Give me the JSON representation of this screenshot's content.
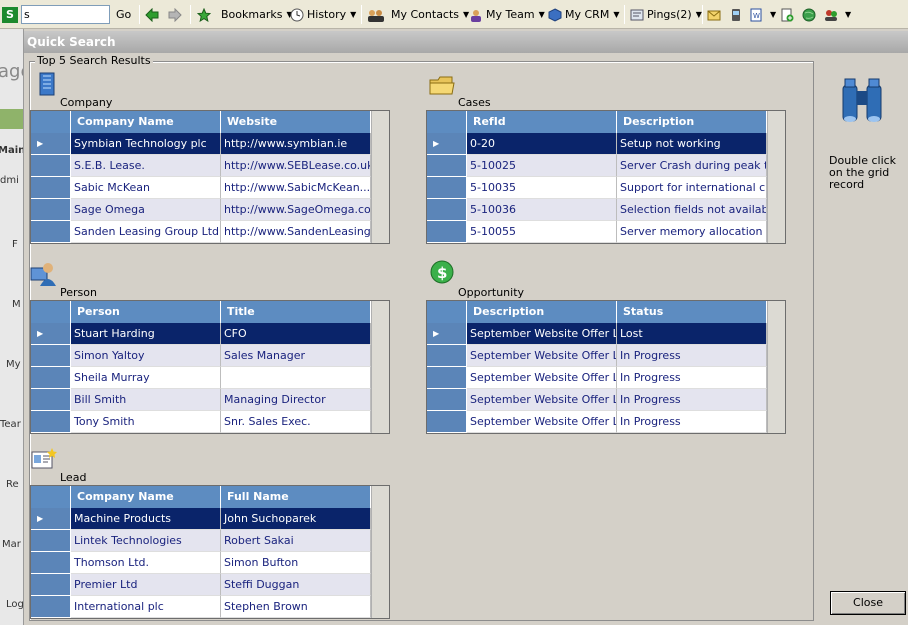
{
  "toolbar": {
    "app_badge": "S",
    "search_value": "s",
    "go_label": "Go",
    "bookmarks_label": "Bookmarks",
    "history_label": "History",
    "contacts_label": "My Contacts",
    "team_label": "My Team",
    "crm_label": "My CRM",
    "pings_label": "Pings(2)"
  },
  "sidebar": {
    "frag_top": "age",
    "frag_main": "Main",
    "frag_admin": "dmi",
    "frag_f": "F",
    "frag_m": "M",
    "frag_my": "My",
    "frag_team": "Tear",
    "frag_re": "Re",
    "frag_mar": "Mar",
    "frag_log": "Log"
  },
  "quick_search": {
    "title": "Quick Search",
    "group_label": "Top 5 Search Results",
    "hint": "Double click on the grid record",
    "close_label": "Close"
  },
  "company": {
    "label": "Company",
    "headers": [
      "Company Name",
      "Website"
    ],
    "rows": [
      [
        "Symbian Technology plc",
        "http://www.symbian.ie"
      ],
      [
        "S.E.B. Lease.",
        "http://www.SEBLease.co.uk"
      ],
      [
        "Sabic McKean",
        "http://www.SabicMcKean...."
      ],
      [
        "Sage Omega",
        "http://www.SageOmega.co..."
      ],
      [
        "Sanden Leasing Group Ltd.",
        "http://www.SandenLeasing..."
      ]
    ]
  },
  "cases": {
    "label": "Cases",
    "headers": [
      "RefId",
      "Description"
    ],
    "rows": [
      [
        "0-20",
        "Setup not working"
      ],
      [
        "5-10025",
        "Server Crash during peak tr..."
      ],
      [
        "5-10035",
        "Support for international cha..."
      ],
      [
        "5-10036",
        "Selection fields not available"
      ],
      [
        "5-10055",
        "Server memory allocation error"
      ]
    ]
  },
  "person": {
    "label": "Person",
    "headers": [
      "Person",
      "Title"
    ],
    "rows": [
      [
        "Stuart Harding",
        "CFO"
      ],
      [
        "Simon Yaltoy",
        "Sales Manager"
      ],
      [
        "Sheila Murray",
        ""
      ],
      [
        "Bill Smith",
        "Managing Director"
      ],
      [
        "Tony Smith",
        "Snr. Sales Exec."
      ]
    ]
  },
  "opportunity": {
    "label": "Opportunity",
    "headers": [
      "Description",
      "Status"
    ],
    "rows": [
      [
        "September Website Offer L...",
        "Lost"
      ],
      [
        "September Website Offer L...",
        "In Progress"
      ],
      [
        "September Website Offer L...",
        "In Progress"
      ],
      [
        "September Website Offer L...",
        "In Progress"
      ],
      [
        "September Website Offer L...",
        "In Progress"
      ]
    ]
  },
  "lead": {
    "label": "Lead",
    "headers": [
      "Company Name",
      "Full Name"
    ],
    "rows": [
      [
        "Machine Products",
        "John Suchoparek"
      ],
      [
        "Lintek Technologies",
        "Robert Sakai"
      ],
      [
        "Thomson Ltd.",
        "Simon Bufton"
      ],
      [
        "Premier Ltd",
        "Steffi Duggan"
      ],
      [
        "International plc",
        "Stephen Brown"
      ]
    ]
  },
  "colors": {
    "header_blue": "#5d8cc1",
    "selected_row": "#0a246a",
    "title_bar": "#a8a8a8"
  },
  "icons": [
    "company-building-icon",
    "cases-folder-icon",
    "person-icon",
    "opportunity-dollar-icon",
    "lead-card-icon",
    "binoculars-icon",
    "row-pointer-icon"
  ]
}
